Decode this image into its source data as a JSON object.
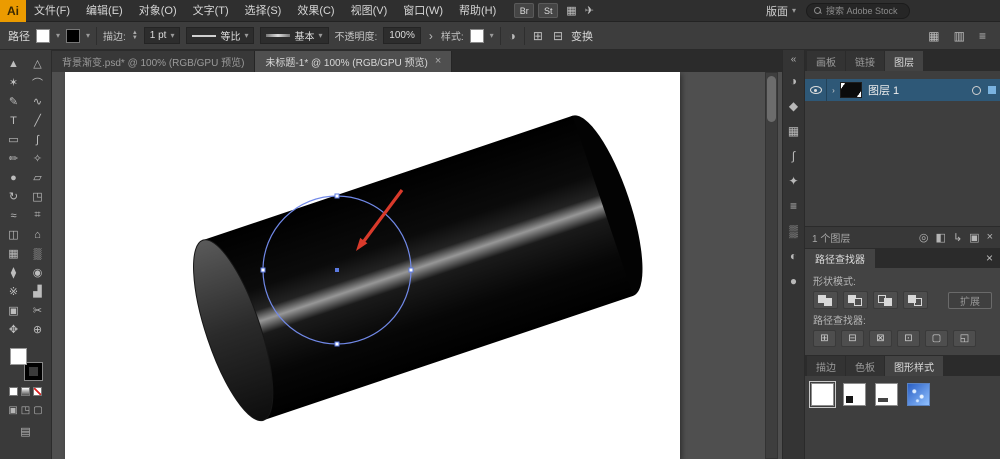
{
  "menubar": {
    "logo": "Ai",
    "items": [
      {
        "name": "file",
        "label": "文件(F)"
      },
      {
        "name": "edit",
        "label": "编辑(E)"
      },
      {
        "name": "object",
        "label": "对象(O)"
      },
      {
        "name": "type",
        "label": "文字(T)"
      },
      {
        "name": "select",
        "label": "选择(S)"
      },
      {
        "name": "effect",
        "label": "效果(C)"
      },
      {
        "name": "view",
        "label": "视图(V)"
      },
      {
        "name": "window",
        "label": "窗口(W)"
      },
      {
        "name": "help",
        "label": "帮助(H)"
      }
    ],
    "badges": [
      {
        "name": "bridge",
        "label": "Br"
      },
      {
        "name": "stock",
        "label": "St"
      }
    ],
    "arrange_icon_glyph": "▦",
    "gpu_icon_glyph": "✈",
    "layout_label": "版面",
    "layout_caret": "▾",
    "search_placeholder": "搜索 Adobe Stock"
  },
  "controlbar": {
    "context_label": "路径",
    "stroke_label": "描边:",
    "stroke_value": "1 pt",
    "profile_label": "等比",
    "brush_label": "基本",
    "opacity_label": "不透明度:",
    "opacity_value": "100%",
    "opacity_more": "›",
    "style_label": "样式:",
    "recolor_glyph": "◑",
    "align_glyph": "⊞",
    "distribute_glyph": "⊟",
    "transform_label": "变换",
    "right_icons": [
      {
        "name": "arrange-documents",
        "glyph": "▦"
      },
      {
        "name": "document-grid",
        "glyph": "▥"
      },
      {
        "name": "control-menu",
        "glyph": "≡"
      }
    ]
  },
  "tabbar": {
    "tabs": [
      {
        "title": "背景渐变.psd* @ 100% (RGB/GPU 预览)"
      },
      {
        "title": "未标题-1* @ 100% (RGB/GPU 预览)"
      }
    ],
    "close_glyph": "×"
  },
  "toolbar": {
    "fill_color": "#ffffff",
    "stroke_color": "#000000",
    "tools": [
      {
        "name": "selection",
        "glyph": "▲"
      },
      {
        "name": "direct-selection",
        "glyph": "△"
      },
      {
        "name": "magic-wand",
        "glyph": "✶"
      },
      {
        "name": "lasso",
        "glyph": "⌒"
      },
      {
        "name": "pen",
        "glyph": "✎"
      },
      {
        "name": "curvature",
        "glyph": "∿"
      },
      {
        "name": "type",
        "glyph": "T"
      },
      {
        "name": "line-segment",
        "glyph": "╱"
      },
      {
        "name": "rectangle",
        "glyph": "▭"
      },
      {
        "name": "paintbrush",
        "glyph": "∫"
      },
      {
        "name": "pencil",
        "glyph": "✏"
      },
      {
        "name": "shaper",
        "glyph": "✧"
      },
      {
        "name": "blob-brush",
        "glyph": "●"
      },
      {
        "name": "eraser",
        "glyph": "▱"
      },
      {
        "name": "rotate",
        "glyph": "↻"
      },
      {
        "name": "scale",
        "glyph": "◳"
      },
      {
        "name": "width",
        "glyph": "≈"
      },
      {
        "name": "free-transform",
        "glyph": "⌗"
      },
      {
        "name": "shape-builder",
        "glyph": "◫"
      },
      {
        "name": "perspective-grid",
        "glyph": "⌂"
      },
      {
        "name": "mesh",
        "glyph": "▦"
      },
      {
        "name": "gradient",
        "glyph": "▒"
      },
      {
        "name": "eyedropper",
        "glyph": "⧫"
      },
      {
        "name": "blend",
        "glyph": "◉"
      },
      {
        "name": "symbol-sprayer",
        "glyph": "※"
      },
      {
        "name": "column-graph",
        "glyph": "▟"
      },
      {
        "name": "artboard",
        "glyph": "▣"
      },
      {
        "name": "slice",
        "glyph": "✂"
      },
      {
        "name": "hand",
        "glyph": "✥"
      },
      {
        "name": "zoom",
        "glyph": "⊕"
      }
    ]
  },
  "dock_strip": {
    "expand_glyph": "«",
    "icons": [
      {
        "name": "color",
        "glyph": "◑"
      },
      {
        "name": "color-guide",
        "glyph": "◆"
      },
      {
        "name": "swatches",
        "glyph": "▦"
      },
      {
        "name": "brushes",
        "glyph": "∫"
      },
      {
        "name": "symbols",
        "glyph": "✦"
      },
      {
        "name": "stroke",
        "glyph": "≡"
      },
      {
        "name": "gradient",
        "glyph": "▒"
      },
      {
        "name": "transparency",
        "glyph": "◐"
      },
      {
        "name": "appearance",
        "glyph": "●"
      }
    ]
  },
  "layers_panel": {
    "tabs": [
      "画板",
      "链接",
      "图层"
    ],
    "layer": {
      "name": "图层 1",
      "expand_glyph": "›"
    },
    "status": "1 个图层",
    "footer_icons": [
      {
        "name": "locate-object",
        "glyph": "◎"
      },
      {
        "name": "make-clip-mask",
        "glyph": "◧"
      },
      {
        "name": "new-sublayer",
        "glyph": "↳"
      },
      {
        "name": "new-layer",
        "glyph": "▣"
      },
      {
        "name": "delete-layer",
        "glyph": "×"
      }
    ]
  },
  "pathfinder_panel": {
    "title": "路径查找器",
    "close_glyph": "×",
    "shape_modes_label": "形状模式:",
    "shape_mode_icons": [
      "unite",
      "minus-front",
      "intersect",
      "exclude"
    ],
    "expand_label": "扩展",
    "pathfinder_label": "路径查找器:",
    "buttons": [
      {
        "name": "divide",
        "glyph": "⊞"
      },
      {
        "name": "trim",
        "glyph": "⊟"
      },
      {
        "name": "merge",
        "glyph": "⊠"
      },
      {
        "name": "crop",
        "glyph": "⊡"
      },
      {
        "name": "outline",
        "glyph": "▢"
      },
      {
        "name": "minus-back",
        "glyph": "◱"
      }
    ]
  },
  "styles_panel": {
    "tabs": [
      "描边",
      "色板",
      "图形样式"
    ],
    "styles": [
      {
        "name": "default"
      },
      {
        "name": "style-2"
      },
      {
        "name": "style-3"
      },
      {
        "name": "blue-texture"
      }
    ]
  },
  "canvas": {
    "selection_color": "#5b79e0",
    "arrow_color": "#d93a2b",
    "artwork": "black-cylinder-with-circle-selection"
  }
}
